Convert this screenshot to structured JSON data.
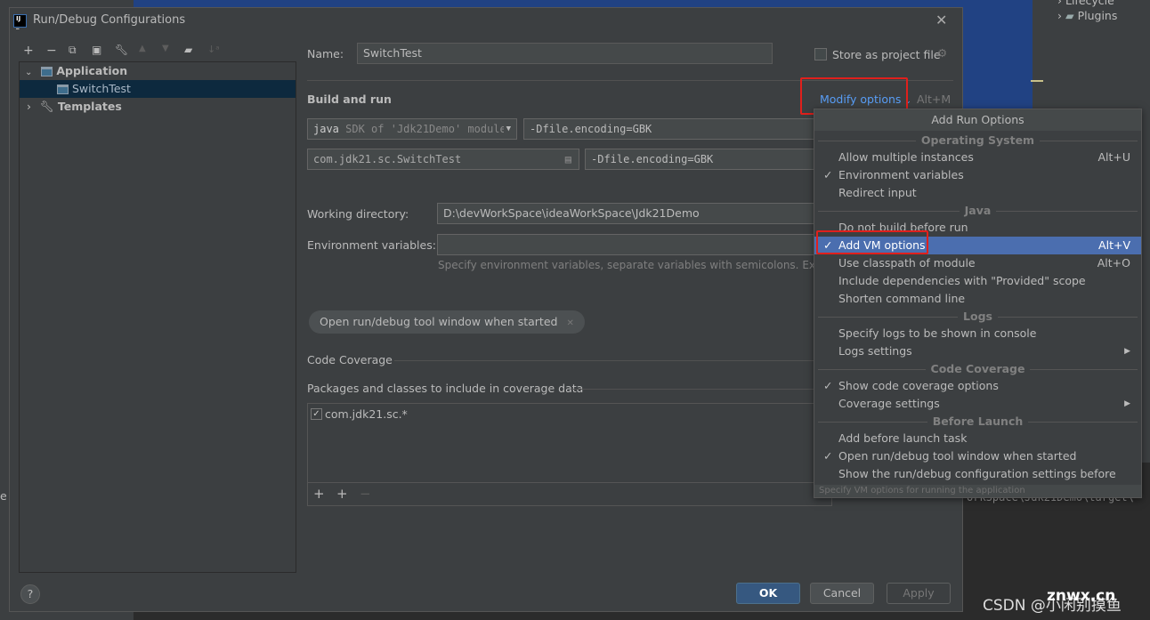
{
  "ide": {
    "tree_items": [
      "Lifecycle",
      "Plugins"
    ],
    "console_text": "orkSpace\\Jdk21Demo\\target\\",
    "left_fragment": "e"
  },
  "dialog": {
    "title": "Run/Debug Configurations",
    "toolbar": [
      "add",
      "remove",
      "copy",
      "save",
      "wrench",
      "move-up",
      "move-down",
      "new-folder",
      "sort"
    ],
    "tree": {
      "items": [
        {
          "label": "Application",
          "expanded": true
        },
        {
          "label": "SwitchTest",
          "selected": true
        },
        {
          "label": "Templates",
          "expanded": false
        }
      ]
    },
    "name_label": "Name:",
    "name_value": "SwitchTest",
    "store_label": "Store as project file",
    "build_run": "Build and run",
    "modify_options": "Modify options",
    "modify_shortcut": "Alt+M",
    "sdk_bold": "java",
    "sdk_rest": "SDK of 'Jdk21Demo' module",
    "vm_options": "-Dfile.encoding=GBK",
    "main_class": "com.jdk21.sc.SwitchTest",
    "program_args": "-Dfile.encoding=GBK",
    "workdir_label": "Working directory:",
    "workdir_value": "D:\\devWorkSpace\\ideaWorkSpace\\Jdk21Demo",
    "env_label": "Environment variables:",
    "env_value": "",
    "env_hint": "Specify environment variables, separate variables with semicolons. Examp",
    "chip": "Open run/debug tool window when started",
    "code_coverage": "Code Coverage",
    "packages_label": "Packages and classes to include in coverage data",
    "package_item": "com.jdk21.sc.*",
    "package_checked": true,
    "ok": "OK",
    "cancel": "Cancel",
    "apply": "Apply",
    "help": "?"
  },
  "menu": {
    "title": "Add Run Options",
    "groups": [
      {
        "name": "Operating System",
        "items": [
          {
            "label": "Allow multiple instances",
            "shortcut": "Alt+U",
            "checked": false
          },
          {
            "label": "Environment variables",
            "checked": true
          },
          {
            "label": "Redirect input",
            "checked": false
          }
        ]
      },
      {
        "name": "Java",
        "items": [
          {
            "label": "Do not build before run",
            "checked": false
          },
          {
            "label": "Add VM options",
            "shortcut": "Alt+V",
            "checked": true,
            "highlighted": true
          },
          {
            "label": "Use classpath of module",
            "shortcut": "Alt+O",
            "checked": false
          },
          {
            "label": "Include dependencies with \"Provided\" scope",
            "checked": false
          },
          {
            "label": "Shorten command line",
            "checked": false
          }
        ]
      },
      {
        "name": "Logs",
        "items": [
          {
            "label": "Specify logs to be shown in console",
            "checked": false
          },
          {
            "label": "Logs settings",
            "submenu": true,
            "checked": false
          }
        ]
      },
      {
        "name": "Code Coverage",
        "items": [
          {
            "label": "Show code coverage options",
            "checked": true
          },
          {
            "label": "Coverage settings",
            "submenu": true,
            "checked": false
          }
        ]
      },
      {
        "name": "Before Launch",
        "items": [
          {
            "label": "Add before launch task",
            "checked": false
          },
          {
            "label": "Open run/debug tool window when started",
            "checked": true
          },
          {
            "label": "Show the run/debug configuration settings before start",
            "checked": false
          }
        ]
      }
    ],
    "footer": "Specify VM options for running the application"
  },
  "watermark": {
    "csdn": "CSDN @小闲别摸鱼",
    "site": "znwx.cn"
  },
  "colors": {
    "accent": "#4b6eaf",
    "highlight_box": "#e0201c",
    "link": "#589df6",
    "ok_button": "#365880"
  }
}
